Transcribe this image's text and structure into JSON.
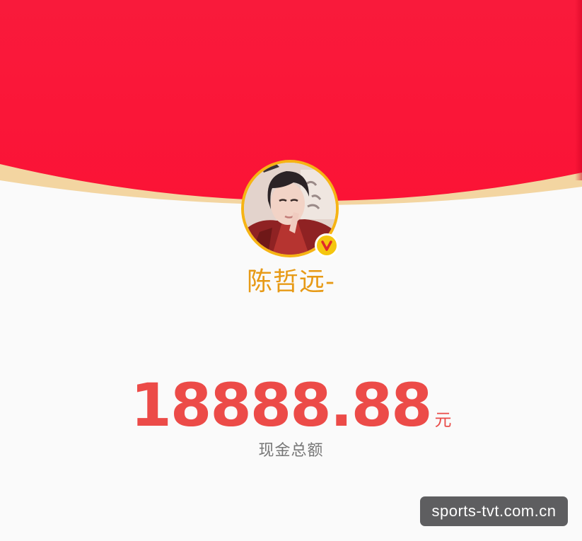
{
  "profile": {
    "username": "陈哲远-",
    "verified_badge": "V"
  },
  "redpacket": {
    "amount": "18888.88",
    "unit": "元",
    "caption": "现金总额"
  },
  "watermark": {
    "text": "sports-tvt.com.cn"
  },
  "colors": {
    "header_red": "#fb1738",
    "header_rim": "#f3d5a1",
    "amount_red": "#ec4b48",
    "username_gold": "#e79a16",
    "avatar_border": "#f6b414"
  },
  "icons": {
    "avatar": "portrait-avatar",
    "badge": "verified-v-icon"
  }
}
